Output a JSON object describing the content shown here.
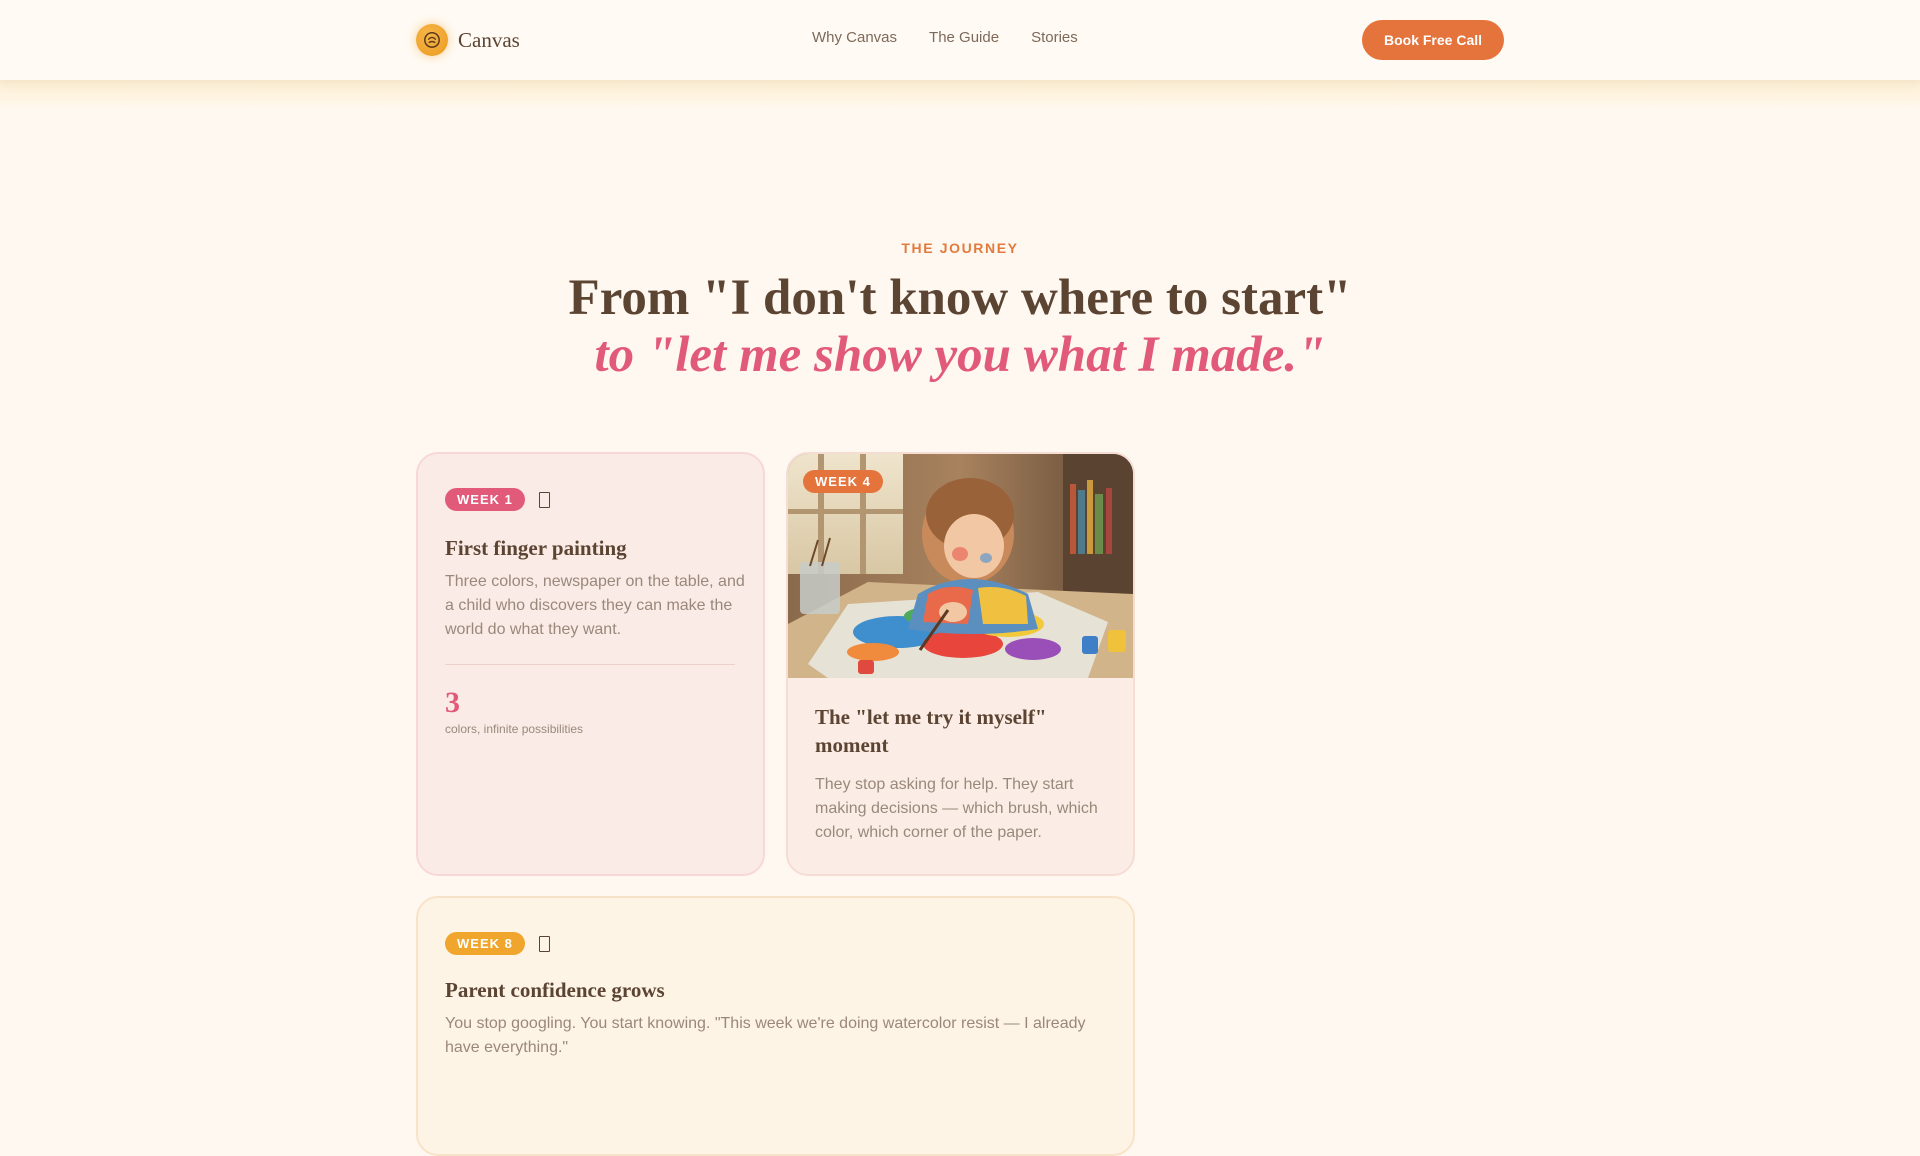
{
  "header": {
    "brand": "Canvas",
    "nav": [
      "Why Canvas",
      "The Guide",
      "Stories"
    ],
    "cta": "Book Free Call"
  },
  "section": {
    "eyebrow": "THE JOURNEY",
    "headline_line1": "From \"I don't know where to start\"",
    "headline_line2": "to \"let me show you what I made.\""
  },
  "cards": [
    {
      "badge": "WEEK 1",
      "title": "First finger painting",
      "text": "Three colors, newspaper on the table, and a child who discovers they can make the world do what they want.",
      "stat_value": "3",
      "stat_label": "colors, infinite possibilities"
    },
    {
      "badge": "WEEK 4",
      "title": "The \"let me try it myself\" moment",
      "text": "They stop asking for help. They start making decisions — which brush, which color, which corner of the paper."
    },
    {
      "badge": "WEEK 8",
      "title": "Parent confidence grows",
      "text": "You stop googling. You start knowing. \"This week we're doing watercolor resist — I already have everything.\""
    }
  ],
  "colors": {
    "accent_orange": "#e4733c",
    "accent_pink": "#e25a7a",
    "accent_amber": "#f0a62c",
    "text_brown": "#5c4433",
    "background": "#fff8f1"
  },
  "icons": [
    "smile-face-icon",
    "bookmark-icon"
  ]
}
